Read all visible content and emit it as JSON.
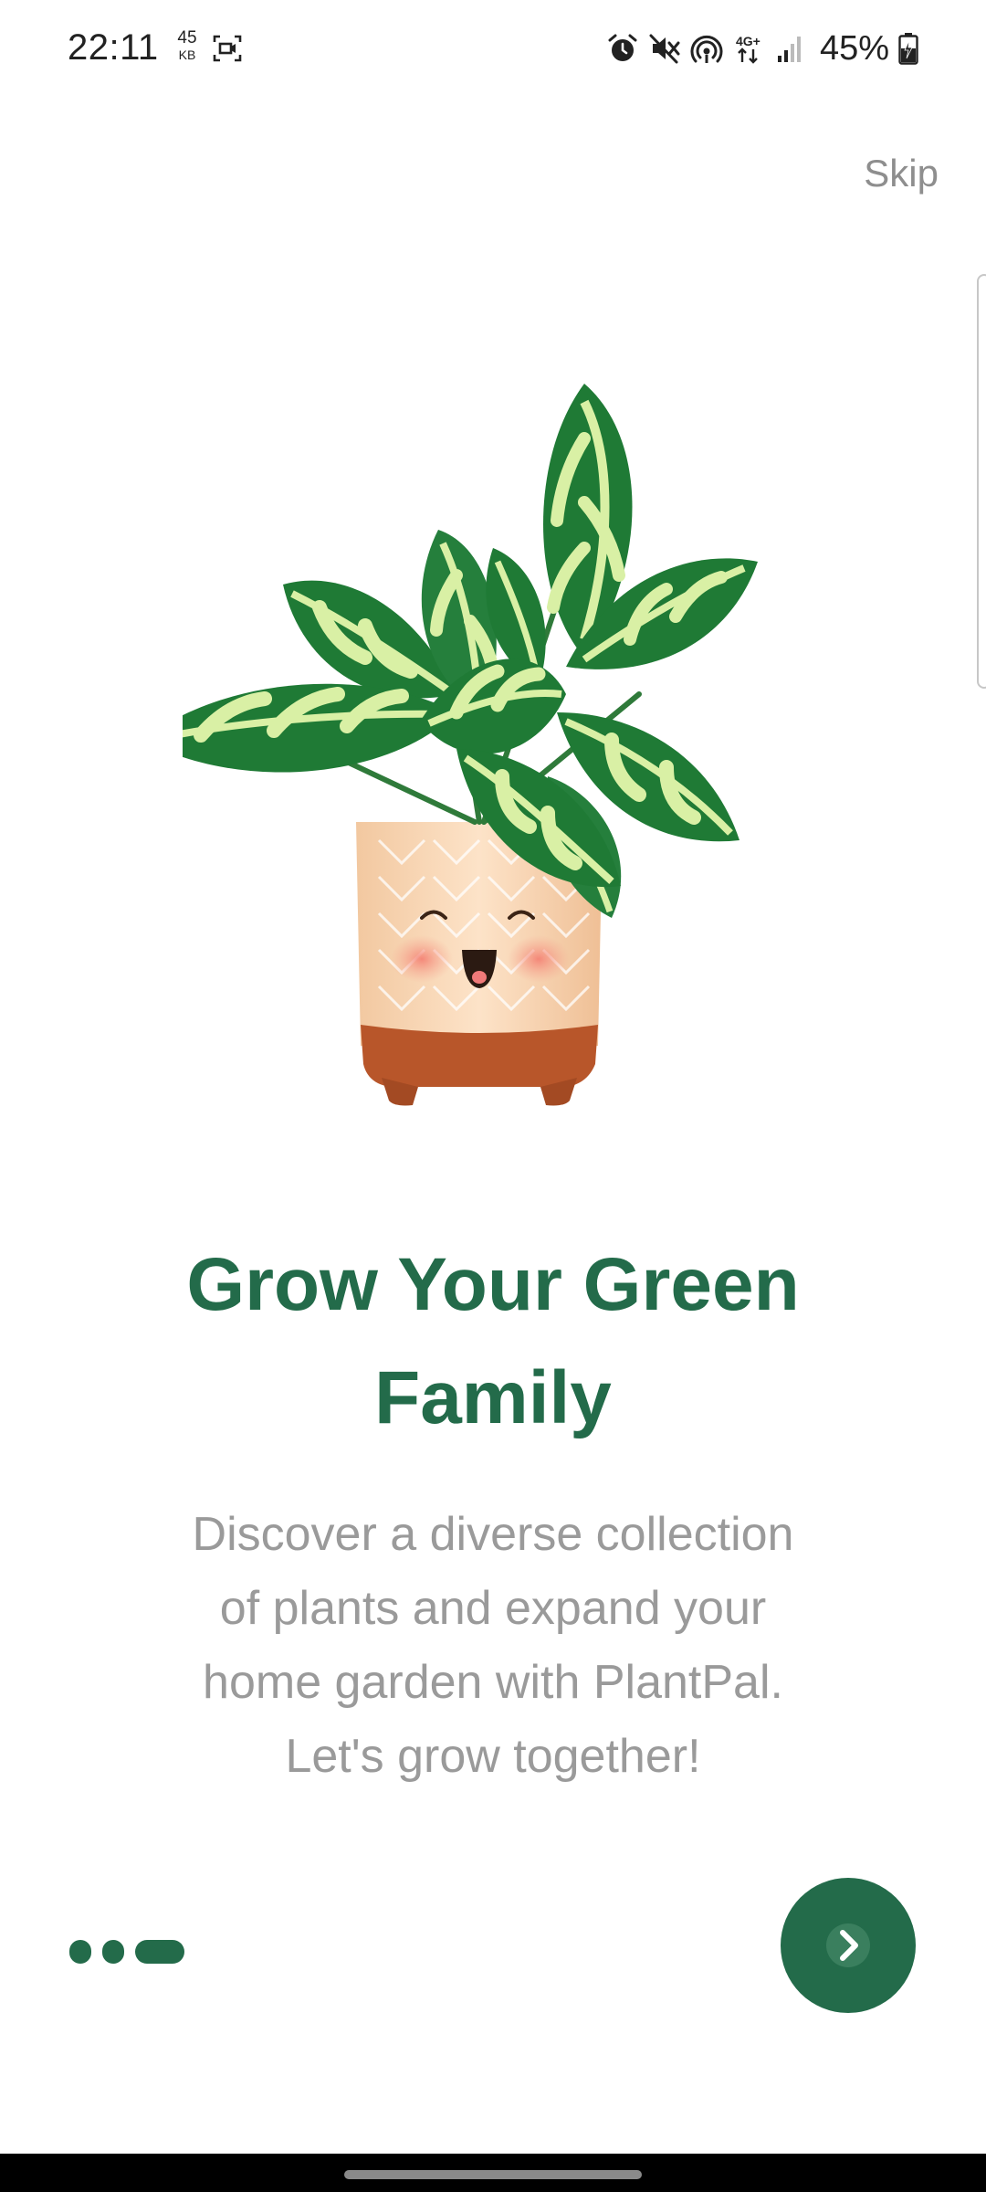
{
  "status_bar": {
    "time": "22:11",
    "net_speed_value": "45",
    "net_speed_unit": "KB",
    "battery_percent": "45%",
    "icons": [
      "screen-record-icon",
      "alarm-icon",
      "mute-icon",
      "hotspot-icon",
      "4g-data-icon",
      "signal-icon",
      "battery-charging-icon"
    ]
  },
  "skip_label": "Skip",
  "onboarding": {
    "illustration": "happy-potted-plant-illustration",
    "title_line1": "Grow Your Green",
    "title_line2": "Family",
    "description_line1": "Discover a diverse collection",
    "description_line2": "of plants and expand your",
    "description_line3": "home garden with PlantPal.",
    "description_line4": "Let's grow together!",
    "page_count": 3,
    "current_page": 3
  },
  "next_button_icon": "chevron-right-icon",
  "colors": {
    "accent": "#236b4a",
    "body_text": "#9a9a9a",
    "skip_text": "#8e8e8e",
    "background": "#ffffff"
  }
}
